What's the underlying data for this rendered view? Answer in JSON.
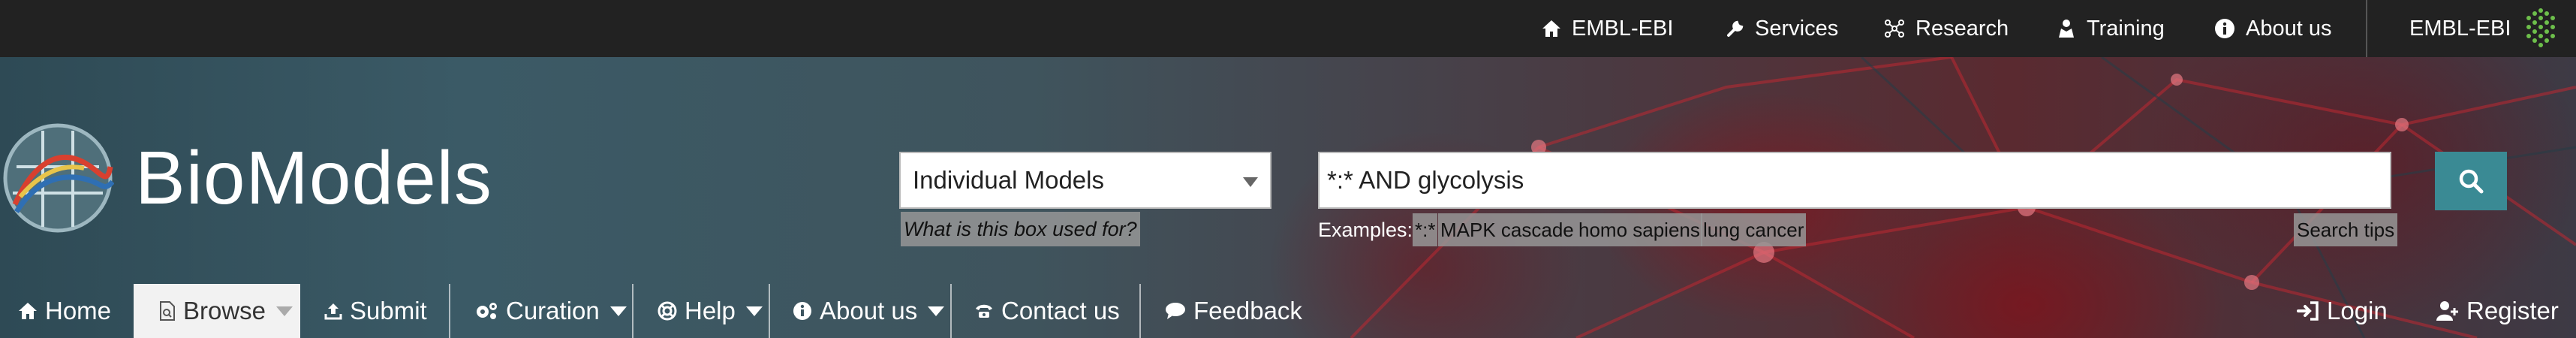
{
  "global_nav": {
    "items": [
      {
        "label": "EMBL-EBI",
        "icon": "home-icon"
      },
      {
        "label": "Services",
        "icon": "wrench-icon"
      },
      {
        "label": "Research",
        "icon": "research-icon"
      },
      {
        "label": "Training",
        "icon": "training-icon"
      },
      {
        "label": "About us",
        "icon": "info-icon"
      }
    ],
    "org_label": "EMBL-EBI"
  },
  "brand": {
    "title": "BioModels"
  },
  "search": {
    "scope_selected": "Individual Models",
    "scope_help": "What is this box used for?",
    "query_value": "*:* AND glycolysis",
    "examples_label": "Examples:",
    "examples": [
      "*:*",
      "MAPK cascade",
      "homo sapiens",
      "lung cancer"
    ],
    "tips_label": "Search tips"
  },
  "main_nav": {
    "items": [
      {
        "label": "Home",
        "icon": "home-icon",
        "dropdown": false
      },
      {
        "label": "Browse",
        "icon": "browse-icon",
        "dropdown": true,
        "active": true
      },
      {
        "label": "Submit",
        "icon": "upload-icon",
        "dropdown": false
      },
      {
        "label": "Curation",
        "icon": "gears-icon",
        "dropdown": true
      },
      {
        "label": "Help",
        "icon": "lifebuoy-icon",
        "dropdown": true
      },
      {
        "label": "About us",
        "icon": "info-icon",
        "dropdown": true
      },
      {
        "label": "Contact us",
        "icon": "phone-icon",
        "dropdown": false
      },
      {
        "label": "Feedback",
        "icon": "comment-icon",
        "dropdown": false
      }
    ],
    "login_label": "Login",
    "register_label": "Register"
  },
  "colors": {
    "global_bar": "#222222",
    "search_button": "#3a8a94",
    "text_on_dark": "#ffffff"
  }
}
